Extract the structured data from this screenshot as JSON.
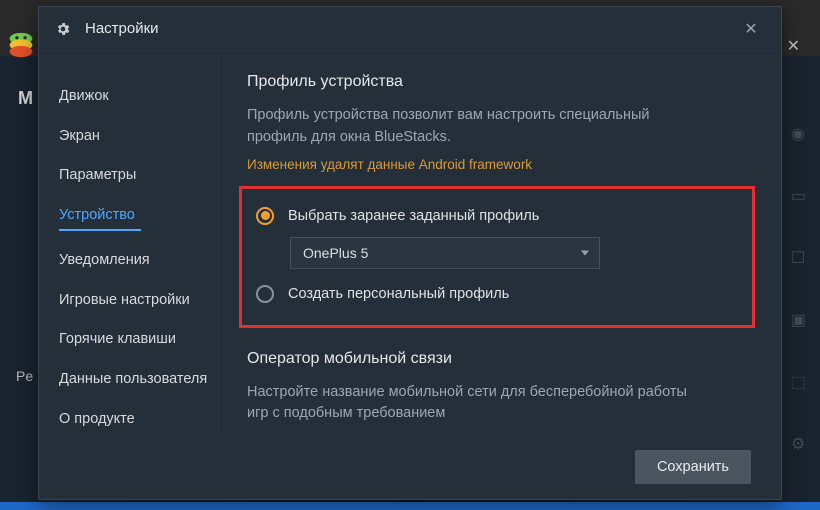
{
  "bg": {
    "letter_left": "M",
    "letter_bottom": "Pe",
    "close_glyph": "✕"
  },
  "modal": {
    "title": "Настройки",
    "close_glyph": "✕"
  },
  "sidebar": {
    "items": [
      {
        "label": "Движок",
        "active": false
      },
      {
        "label": "Экран",
        "active": false
      },
      {
        "label": "Параметры",
        "active": false
      },
      {
        "label": "Устройство",
        "active": true
      },
      {
        "label": "Уведомления",
        "active": false
      },
      {
        "label": "Игровые настройки",
        "active": false
      },
      {
        "label": "Горячие клавиши",
        "active": false
      },
      {
        "label": "Данные пользователя",
        "active": false
      },
      {
        "label": "О продукте",
        "active": false
      }
    ]
  },
  "content": {
    "section1": {
      "title": "Профиль устройства",
      "desc": "Профиль устройства позволит вам настроить специальный профиль для окна BlueStacks.",
      "warn": "Изменения удалят данные Android framework",
      "radio_preset_label": "Выбрать заранее заданный профиль",
      "preset_selected": "OnePlus 5",
      "radio_custom_label": "Создать персональный профиль"
    },
    "section2": {
      "title": "Оператор мобильной связи",
      "desc": "Настройте название мобильной сети для бесперебойной работы игр с подобным требованием"
    }
  },
  "footer": {
    "save_label": "Сохранить"
  }
}
